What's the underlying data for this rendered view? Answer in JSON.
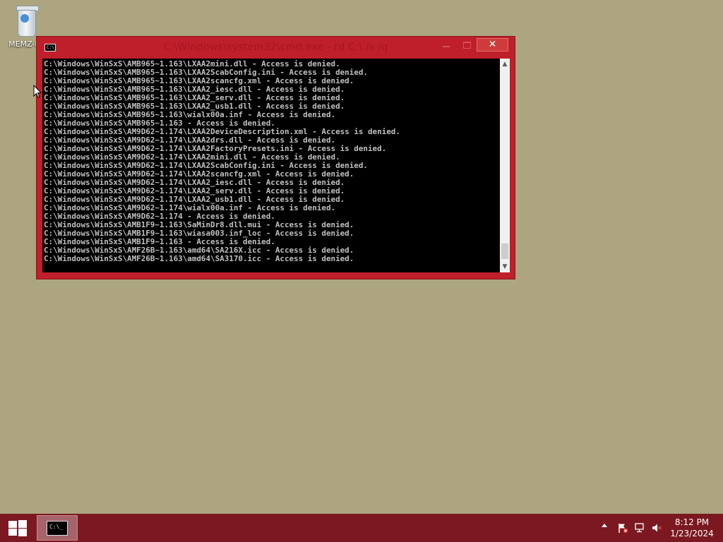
{
  "desktop": {
    "icons": [
      {
        "label": "MEMZ-D",
        "icon": "recycle-bin-icon"
      }
    ]
  },
  "window": {
    "title": "C:\\Windows\\system32\\cmd.exe - rd C:\\ /s /q",
    "close_glyph": "✕",
    "lines": [
      "C:\\Windows\\WinSxS\\AMB965~1.163\\LXAA2mini.dll - Access is denied.",
      "C:\\Windows\\WinSxS\\AMB965~1.163\\LXAA2ScabConfig.ini - Access is denied.",
      "C:\\Windows\\WinSxS\\AMB965~1.163\\LXAA2scancfg.xml - Access is denied.",
      "C:\\Windows\\WinSxS\\AMB965~1.163\\LXAA2_iesc.dll - Access is denied.",
      "C:\\Windows\\WinSxS\\AMB965~1.163\\LXAA2_serv.dll - Access is denied.",
      "C:\\Windows\\WinSxS\\AMB965~1.163\\LXAA2_usb1.dll - Access is denied.",
      "C:\\Windows\\WinSxS\\AMB965~1.163\\wialx00a.inf - Access is denied.",
      "C:\\Windows\\WinSxS\\AMB965~1.163 - Access is denied.",
      "C:\\Windows\\WinSxS\\AM9D62~1.174\\LXAA2DeviceDescription.xml - Access is denied.",
      "C:\\Windows\\WinSxS\\AM9D62~1.174\\LXAA2drs.dll - Access is denied.",
      "C:\\Windows\\WinSxS\\AM9D62~1.174\\LXAA2FactoryPresets.ini - Access is denied.",
      "C:\\Windows\\WinSxS\\AM9D62~1.174\\LXAA2mini.dll - Access is denied.",
      "C:\\Windows\\WinSxS\\AM9D62~1.174\\LXAA2ScabConfig.ini - Access is denied.",
      "C:\\Windows\\WinSxS\\AM9D62~1.174\\LXAA2scancfg.xml - Access is denied.",
      "C:\\Windows\\WinSxS\\AM9D62~1.174\\LXAA2_iesc.dll - Access is denied.",
      "C:\\Windows\\WinSxS\\AM9D62~1.174\\LXAA2_serv.dll - Access is denied.",
      "C:\\Windows\\WinSxS\\AM9D62~1.174\\LXAA2_usb1.dll - Access is denied.",
      "C:\\Windows\\WinSxS\\AM9D62~1.174\\wialx00a.inf - Access is denied.",
      "C:\\Windows\\WinSxS\\AM9D62~1.174 - Access is denied.",
      "C:\\Windows\\WinSxS\\AMB1F9~1.163\\SaMinDr8.dll.mui - Access is denied.",
      "C:\\Windows\\WinSxS\\AMB1F9~1.163\\wiasa003.inf_loc - Access is denied.",
      "C:\\Windows\\WinSxS\\AMB1F9~1.163 - Access is denied.",
      "C:\\Windows\\WinSxS\\AMF26B~1.163\\amd64\\SA216X.icc - Access is denied.",
      "C:\\Windows\\WinSxS\\AMF26B~1.163\\amd64\\SA3170.icc - Access is denied."
    ]
  },
  "taskbar": {
    "tasks": [
      {
        "icon": "cmd-icon",
        "glyph": "C:\\_"
      }
    ],
    "time": "8:12 PM",
    "date": "1/23/2024"
  },
  "colors": {
    "desktop": "#aca57f",
    "window_frame": "#bf1f2b",
    "taskbar": "#7b1820",
    "console_bg": "#000000",
    "console_text": "#c0c0c0"
  }
}
